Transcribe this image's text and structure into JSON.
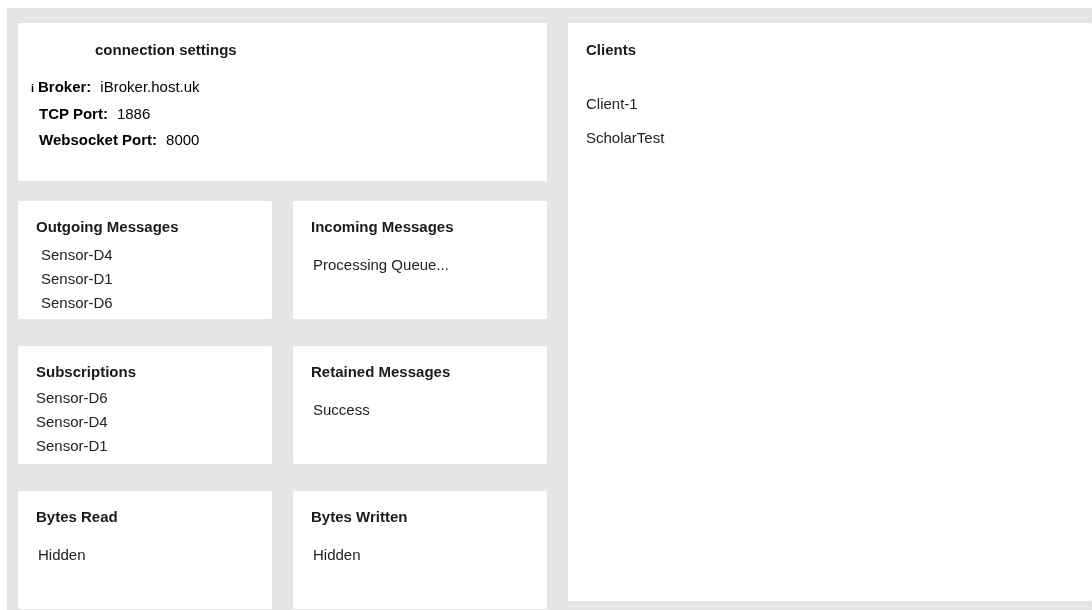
{
  "connection_settings": {
    "title": "connection settings",
    "marker": "i",
    "fields": [
      {
        "label": "Broker:",
        "value": "iBroker.host.uk"
      },
      {
        "label": "TCP Port:",
        "value": "1886"
      },
      {
        "label": "Websocket Port:",
        "value": "8000"
      }
    ]
  },
  "panels": [
    {
      "title": "Outgoing Messages",
      "kind": "list",
      "items": [
        "Sensor-D4",
        "Sensor-D1",
        "Sensor-D6"
      ]
    },
    {
      "title": "Incoming Messages",
      "kind": "status",
      "items": [
        "Processing Queue..."
      ]
    },
    {
      "title": "Subscriptions",
      "kind": "tight",
      "items": [
        "Sensor-D6",
        "Sensor-D4",
        "Sensor-D1"
      ]
    },
    {
      "title": "Retained Messages",
      "kind": "status",
      "items": [
        "Success"
      ]
    },
    {
      "title": "Bytes Read",
      "kind": "status",
      "items": [
        "Hidden"
      ]
    },
    {
      "title": "Bytes Written",
      "kind": "status",
      "items": [
        "Hidden"
      ]
    }
  ],
  "clients": {
    "title": "Clients",
    "items": [
      "Client-1",
      "ScholarTest"
    ]
  }
}
